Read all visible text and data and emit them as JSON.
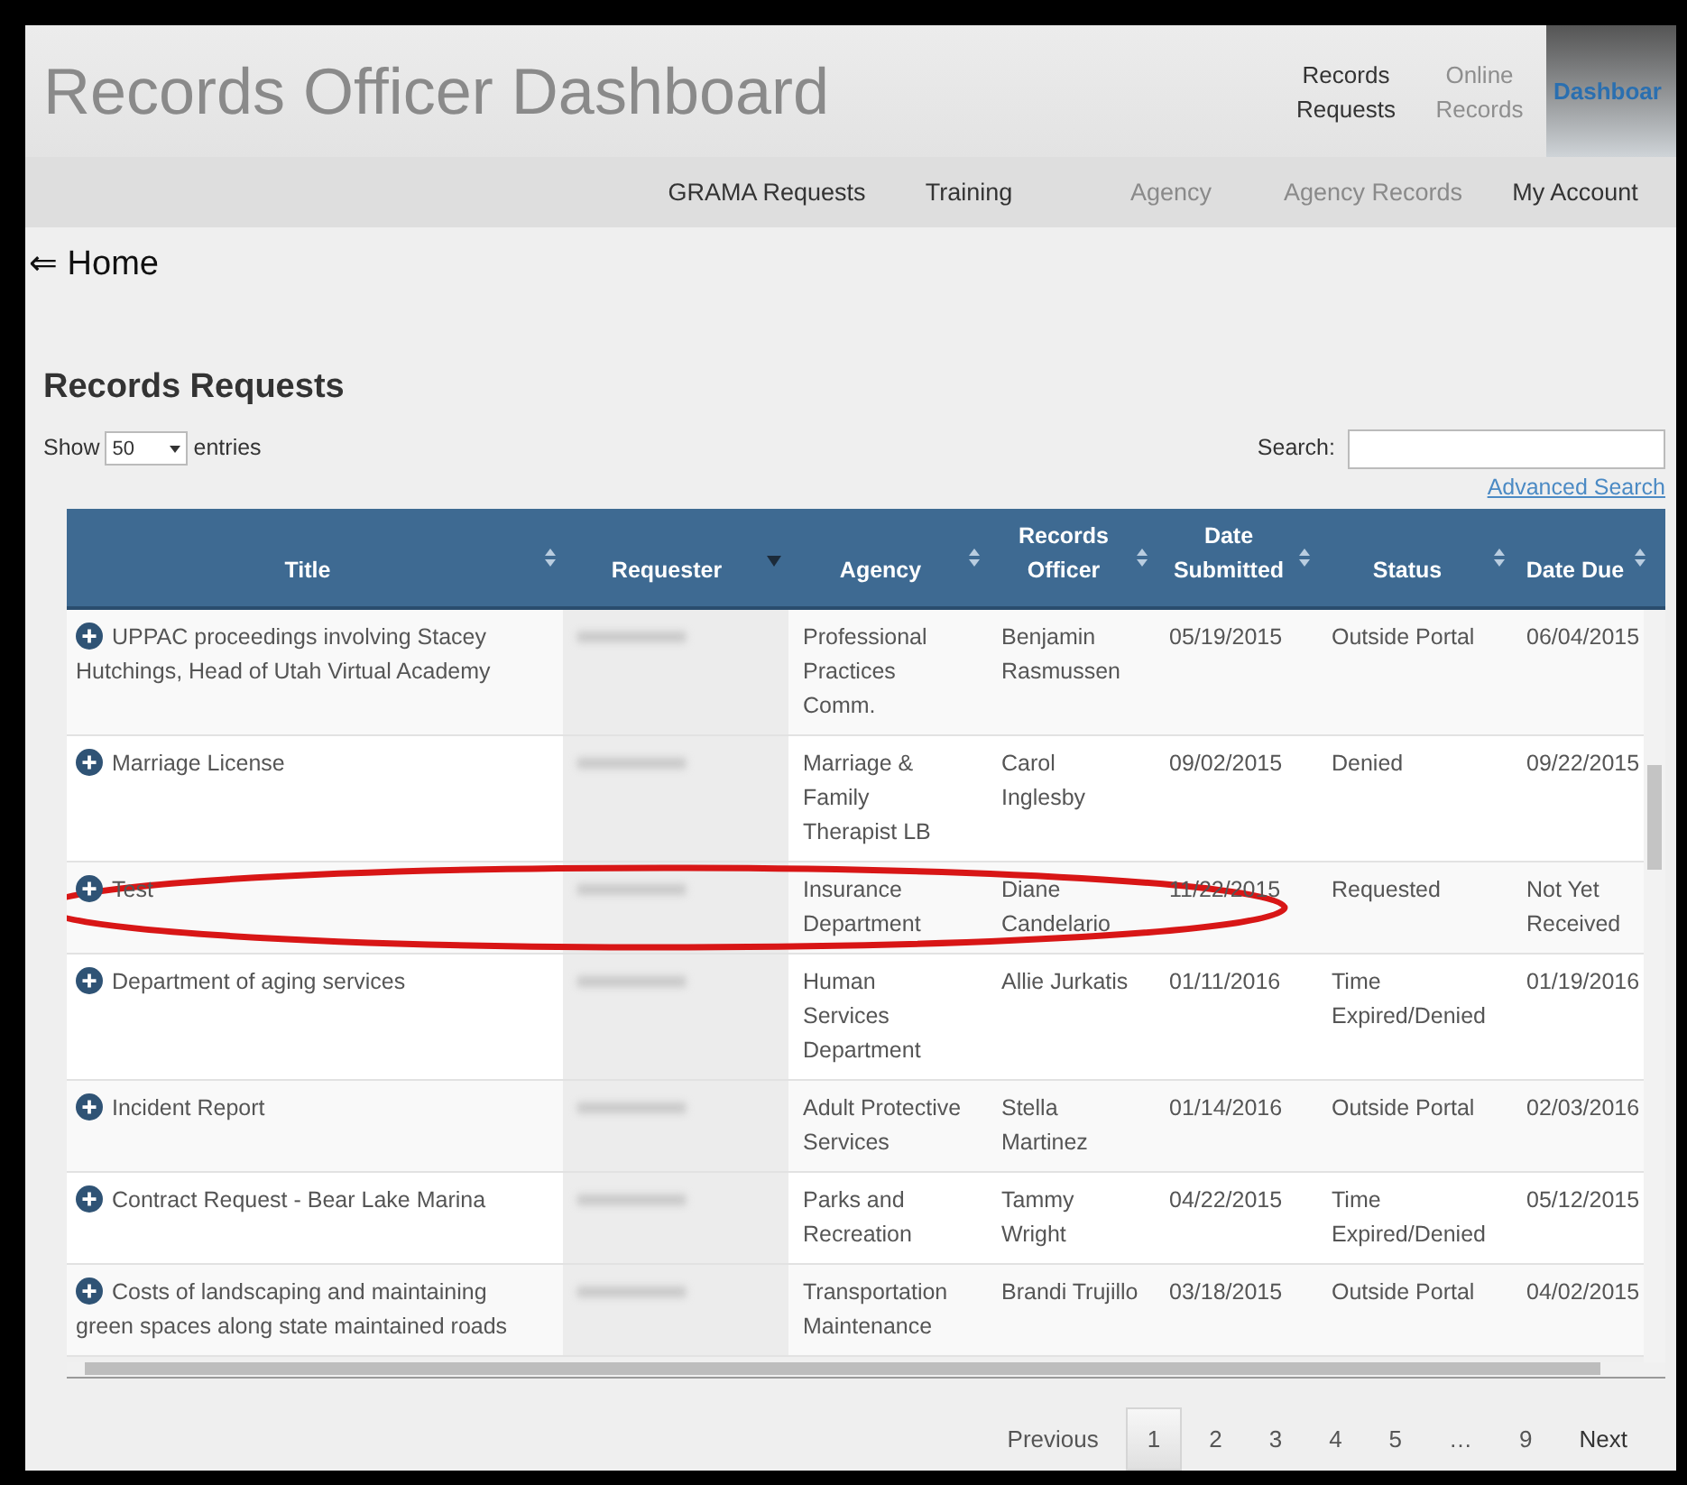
{
  "header": {
    "title": "Records Officer Dashboard",
    "top_nav": [
      {
        "label": "Records Requests",
        "disabled": false,
        "selected": false
      },
      {
        "label": "Online Records",
        "disabled": true,
        "selected": false
      },
      {
        "label": "Dashboar",
        "disabled": false,
        "selected": true
      }
    ],
    "main_nav": [
      {
        "label": "GRAMA Requests",
        "disabled": false
      },
      {
        "label": "Training",
        "disabled": false
      },
      {
        "label": "Agency",
        "disabled": true
      },
      {
        "label": "Agency Records",
        "disabled": true
      },
      {
        "label": "My Account",
        "disabled": false
      }
    ]
  },
  "back_link": "⇐ Home",
  "section_title": "Records Requests",
  "length_control": {
    "prefix": "Show",
    "value": "50",
    "suffix": "entries"
  },
  "search": {
    "label": "Search:"
  },
  "advanced_search": "Advanced Search",
  "table": {
    "columns": [
      {
        "label": "Title",
        "sorted": false
      },
      {
        "label": "Requester",
        "sorted": true
      },
      {
        "label": "Agency",
        "sorted": false
      },
      {
        "label": "Records Officer",
        "sorted": false
      },
      {
        "label": "Date Submitted",
        "sorted": false
      },
      {
        "label": "Status",
        "sorted": false
      },
      {
        "label": "Date Due",
        "sorted": false
      }
    ],
    "rows": [
      {
        "title": "UPPAC proceedings involving Stacey Hutchings, Head of Utah Virtual Academy",
        "agency": "Professional Practices Comm.",
        "officer": "Benjamin Rasmussen",
        "submitted": "05/19/2015",
        "status": "Outside Portal",
        "due": "06/04/2015"
      },
      {
        "title": "Marriage License",
        "agency": "Marriage & Family Therapist LB",
        "officer": "Carol Inglesby",
        "submitted": "09/02/2015",
        "status": "Denied",
        "due": "09/22/2015"
      },
      {
        "title": "Test",
        "agency": "Insurance Department",
        "officer": "Diane Candelario",
        "submitted": "11/22/2015",
        "status": "Requested",
        "due": "Not Yet Received",
        "circled": true
      },
      {
        "title": "Department of aging services",
        "agency": "Human Services Department",
        "officer": "Allie Jurkatis",
        "submitted": "01/11/2016",
        "status": "Time Expired/Denied",
        "due": "01/19/2016"
      },
      {
        "title": "Incident Report",
        "agency": "Adult Protective Services",
        "officer": "Stella Martinez",
        "submitted": "01/14/2016",
        "status": "Outside Portal",
        "due": "02/03/2016"
      },
      {
        "title": "Contract Request - Bear Lake Marina",
        "agency": "Parks and Recreation",
        "officer": "Tammy Wright",
        "submitted": "04/22/2015",
        "status": "Time Expired/Denied",
        "due": "05/12/2015"
      },
      {
        "title": "Costs of landscaping and maintaining green spaces along state maintained roads",
        "agency": "Transportation Maintenance",
        "officer": "Brandi Trujillo",
        "submitted": "03/18/2015",
        "status": "Outside Portal",
        "due": "04/02/2015"
      }
    ]
  },
  "pagination": [
    {
      "label": "Previous",
      "selected": false
    },
    {
      "label": "1",
      "selected": true
    },
    {
      "label": "2",
      "selected": false
    },
    {
      "label": "3",
      "selected": false
    },
    {
      "label": "4",
      "selected": false
    },
    {
      "label": "5",
      "selected": false
    },
    {
      "label": "…",
      "selected": false
    },
    {
      "label": "9",
      "selected": false
    },
    {
      "label": "Next",
      "selected": false
    }
  ]
}
